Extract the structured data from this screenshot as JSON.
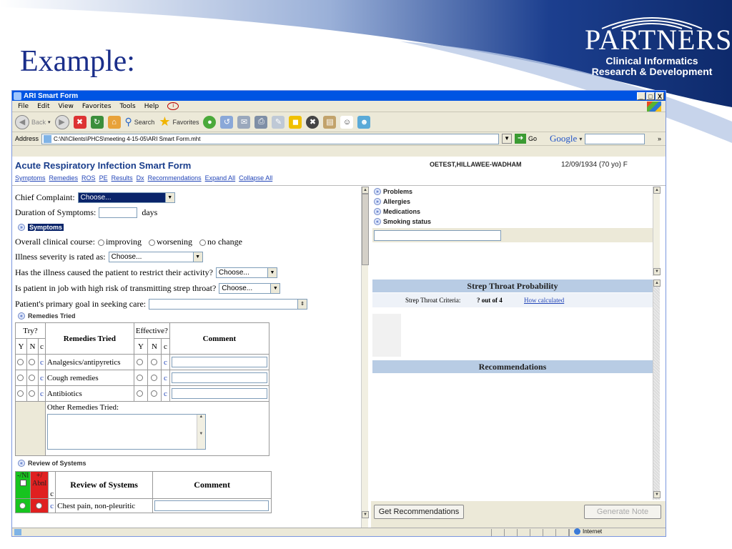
{
  "slide": {
    "title": "Example:",
    "logo_word": "PARTNERS",
    "logo_sub_1": "Clinical Informatics",
    "logo_sub_2": "Research & Development"
  },
  "window": {
    "title": "ARI Smart Form",
    "controls": [
      "_",
      "□",
      "X"
    ]
  },
  "menu": [
    "File",
    "Edit",
    "View",
    "Favorites",
    "Tools",
    "Help"
  ],
  "toolbar": {
    "back": "Back",
    "search": "Search",
    "favorites": "Favorites"
  },
  "address": {
    "label": "Address",
    "value": "C:\\NI\\Clients\\PHCS\\meeting 4-15-05\\ARI Smart Form.mht",
    "go": "Go",
    "google": "Google"
  },
  "form": {
    "title": "Acute Respiratory Infection Smart Form",
    "patient_name": "OETEST,HILLAWEE-WADHAM",
    "dob": "12/09/1934 (70 yo)  F",
    "nav": [
      "Symptoms",
      "Remedies",
      "ROS",
      "PE",
      "Results",
      "Dx",
      "Recommendations",
      "Expand All",
      "Collapse All"
    ]
  },
  "left": {
    "chief_complaint_label": "Chief Complaint:",
    "chief_complaint_value": "Choose...",
    "duration_label": "Duration of Symptoms:",
    "duration_unit": "days",
    "symptoms_header": "Symptoms",
    "course_label": "Overall clinical course:",
    "course_options": [
      "improving",
      "worsening",
      "no change"
    ],
    "severity_label": "Illness severity is rated as:",
    "severity_value": "Choose...",
    "restrict_label": "Has the illness caused the patient to restrict their activity?",
    "restrict_value": "Choose...",
    "strep_job_label": "Is patient in job with high risk of transmitting strep throat?",
    "strep_job_value": "Choose...",
    "goal_label": "Patient's primary goal in seeking care:",
    "remedies_header": "Remedies Tried",
    "remedies_table": {
      "try_header": "Try?",
      "remedies_header": "Remedies Tried",
      "effective_header": "Effective?",
      "comment_header": "Comment",
      "y": "Y",
      "n": "N",
      "c": "c",
      "rows": [
        "Analgesics/antipyretics",
        "Cough remedies",
        "Antibiotics"
      ],
      "other_label": "Other Remedies Tried:"
    },
    "ros_header": "Review of Systems",
    "ros_table": {
      "nl_label": "-/Nl",
      "abnl_label": "+/ Abnl",
      "c": "c",
      "title": "Review of Systems",
      "comment": "Comment",
      "first_row": "Chest pain, non-pleuritic"
    }
  },
  "right": {
    "items": [
      "Problems",
      "Allergies",
      "Medications",
      "Smoking status"
    ],
    "strep_title": "Strep Throat Probability",
    "strep_criteria_label": "Strep Throat Criteria:",
    "strep_criteria_value": "? out of 4",
    "how_calculated": "How calculated",
    "recommendations_title": "Recommendations",
    "get_recommendations": "Get Recommendations",
    "generate_note": "Generate Note"
  },
  "status": {
    "zone": "Internet"
  }
}
